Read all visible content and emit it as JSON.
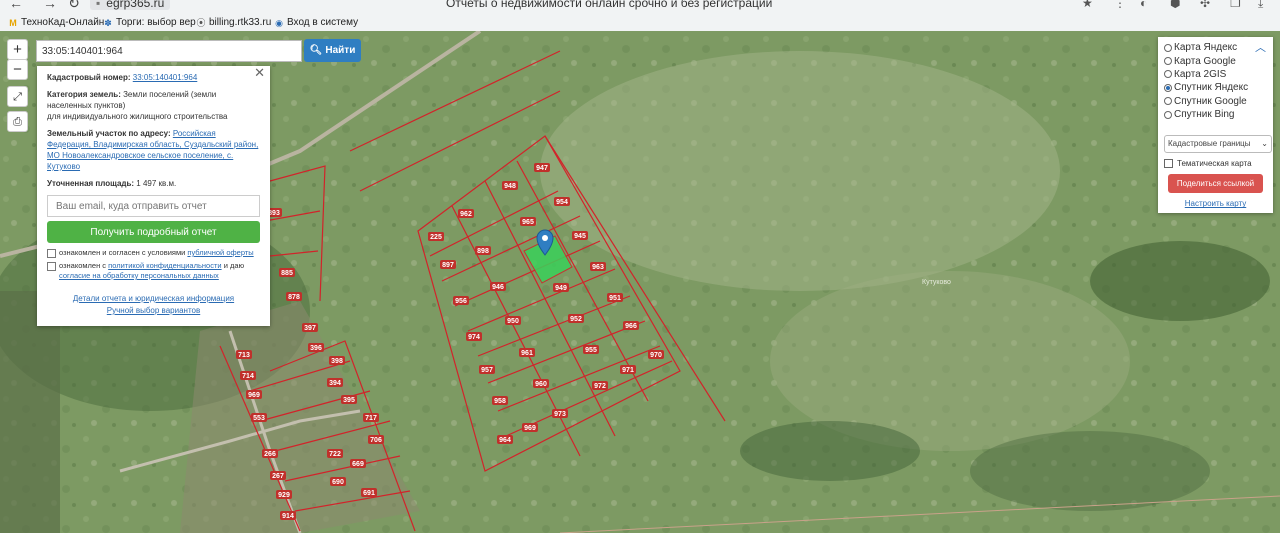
{
  "browser": {
    "url": "egrp365.ru",
    "page_title": "Отчеты о недвижимости онлайн срочно и без регистрации",
    "bookmarks": [
      {
        "label": "ТехноКад-Онлайн",
        "icon": "tehnokad-icon"
      },
      {
        "label": "Торги: выбор вер",
        "icon": "torgi-icon"
      },
      {
        "label": "billing.rtk33.ru",
        "icon": "location-pin-icon"
      },
      {
        "label": "Вход в систему",
        "icon": "globe-icon"
      }
    ]
  },
  "search": {
    "value": "33:05:140401:964",
    "button_label": "Найти"
  },
  "map_controls": {
    "zoom_in": "+",
    "zoom_out": "−"
  },
  "info": {
    "cadastral_label": "Кадастровый номер:",
    "cadastral_value": "33:05:140401:964",
    "category_label": "Категория земель:",
    "category_value": "Земли поселений (земли населенных пунктов)",
    "category_use": "для индивидуального жилищного строительства",
    "address_label": "Земельный участок по адресу:",
    "address_value": "Российская Федерация, Владимирская область, Суздальский район, МО Новоалександровское сельское поселение, с. Кутуково",
    "area_label": "Уточненная площадь:",
    "area_value": "1 497 кв.м.",
    "email_placeholder": "Ваш email, куда отправить отчет",
    "report_button": "Получить подробный отчет",
    "consent1_prefix": "ознакомлен и согласен с условиями",
    "consent1_link": "публичной оферты",
    "consent2_prefix": "ознакомлен с",
    "consent2_link1": "политикой конфиденциальности",
    "consent2_mid": "и даю",
    "consent2_link2": "согласие на обработку персональных данных",
    "details_link": "Детали отчета и юридическая информация",
    "manual_link": "Ручной выбор вариантов"
  },
  "layers": {
    "options": [
      {
        "label": "Карта Яндекс",
        "selected": false
      },
      {
        "label": "Карта Google",
        "selected": false
      },
      {
        "label": "Карта 2GIS",
        "selected": false
      },
      {
        "label": "Спутник Яндекс",
        "selected": true
      },
      {
        "label": "Спутник Google",
        "selected": false
      },
      {
        "label": "Спутник Bing",
        "selected": false
      }
    ],
    "overlay_select": "Кадастровые границы",
    "thematic_label": "Тематическая карта",
    "share_button": "Поделиться ссылкой",
    "setup_link": "Настроить карту"
  },
  "parcels": [
    "947",
    "948",
    "954",
    "962",
    "965",
    "945",
    "225",
    "898",
    "963",
    "897",
    "946",
    "949",
    "951",
    "956",
    "950",
    "952",
    "966",
    "974",
    "961",
    "955",
    "970",
    "957",
    "960",
    "971",
    "972",
    "958",
    "969",
    "973",
    "964",
    "713",
    "714",
    "969",
    "553",
    "397",
    "396",
    "398",
    "394",
    "395",
    "717",
    "706",
    "722",
    "669",
    "690",
    "266",
    "267",
    "929",
    "914",
    "691",
    "885",
    "878",
    "893",
    "225"
  ],
  "map_label": "Кутуково",
  "colors": {
    "parcel_border": "#d2232a",
    "selected_parcel": "#3bd15a",
    "search_button": "#2f7ec2",
    "report_button": "#4fb245",
    "share_button": "#d9534f"
  }
}
